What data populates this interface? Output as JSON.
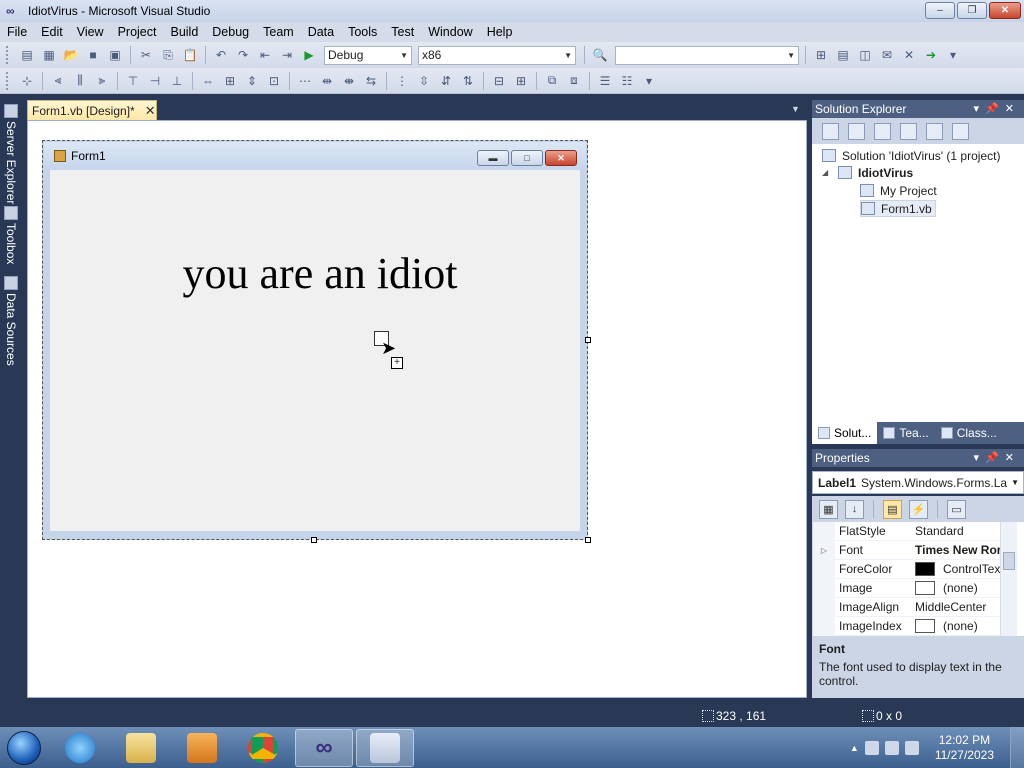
{
  "window": {
    "title": "IdiotVirus - Microsoft Visual Studio",
    "controls": {
      "minimize": "–",
      "maximize": "❐",
      "close": "✕"
    }
  },
  "menu": [
    "File",
    "Edit",
    "View",
    "Project",
    "Build",
    "Debug",
    "Team",
    "Data",
    "Tools",
    "Test",
    "Window",
    "Help"
  ],
  "toolbar": {
    "config": "Debug",
    "platform": "x86",
    "find_value": ""
  },
  "left_tabs": {
    "server_explorer": "Server Explorer",
    "toolbox": "Toolbox",
    "data_sources": "Data Sources"
  },
  "document": {
    "tab_label": "Form1.vb [Design]*",
    "form_title": "Form1",
    "label_text": "you are an idiot"
  },
  "solution_explorer": {
    "title": "Solution Explorer",
    "solution": "Solution 'IdiotVirus' (1 project)",
    "project": "IdiotVirus",
    "my_project": "My Project",
    "form_file": "Form1.vb",
    "tabs": [
      "Solut...",
      "Tea...",
      "Class..."
    ]
  },
  "properties": {
    "title": "Properties",
    "object_name": "Label1",
    "object_type": "System.Windows.Forms.La",
    "rows": [
      {
        "name": "FlatStyle",
        "value": "Standard"
      },
      {
        "name": "Font",
        "value": "Times New Ror"
      },
      {
        "name": "ForeColor",
        "value": "ControlTex"
      },
      {
        "name": "Image",
        "value": "(none)"
      },
      {
        "name": "ImageAlign",
        "value": "MiddleCenter"
      },
      {
        "name": "ImageIndex",
        "value": "(none)"
      }
    ],
    "desc_title": "Font",
    "desc_text": "The font used to display text in the control."
  },
  "status": {
    "position": "323 , 161",
    "size": "0 x 0"
  },
  "clock": {
    "time": "12:02 PM",
    "date": "11/27/2023"
  },
  "colors": {
    "ide_background": "#293955",
    "forecolor_swatch": "#000000"
  }
}
